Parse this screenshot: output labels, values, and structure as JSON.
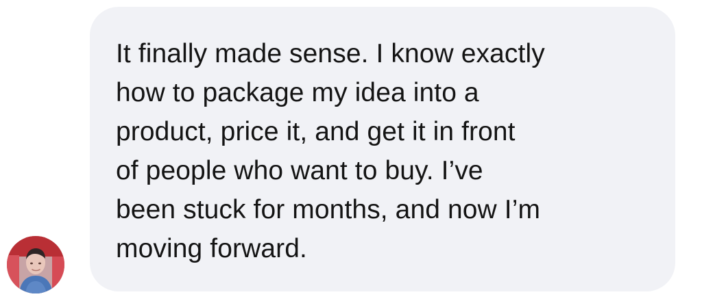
{
  "message": {
    "sender": {
      "avatar_icon": "person-photo-icon"
    },
    "bubble": {
      "text": "It finally made sense. I know exactly\nhow to package my idea into a\nproduct, price it, and get it in front\nof people who want to buy. I’ve\nbeen stuck for months, and now I’m\nmoving forward.",
      "background_color": "#f1f2f6",
      "text_color": "#141414"
    }
  }
}
